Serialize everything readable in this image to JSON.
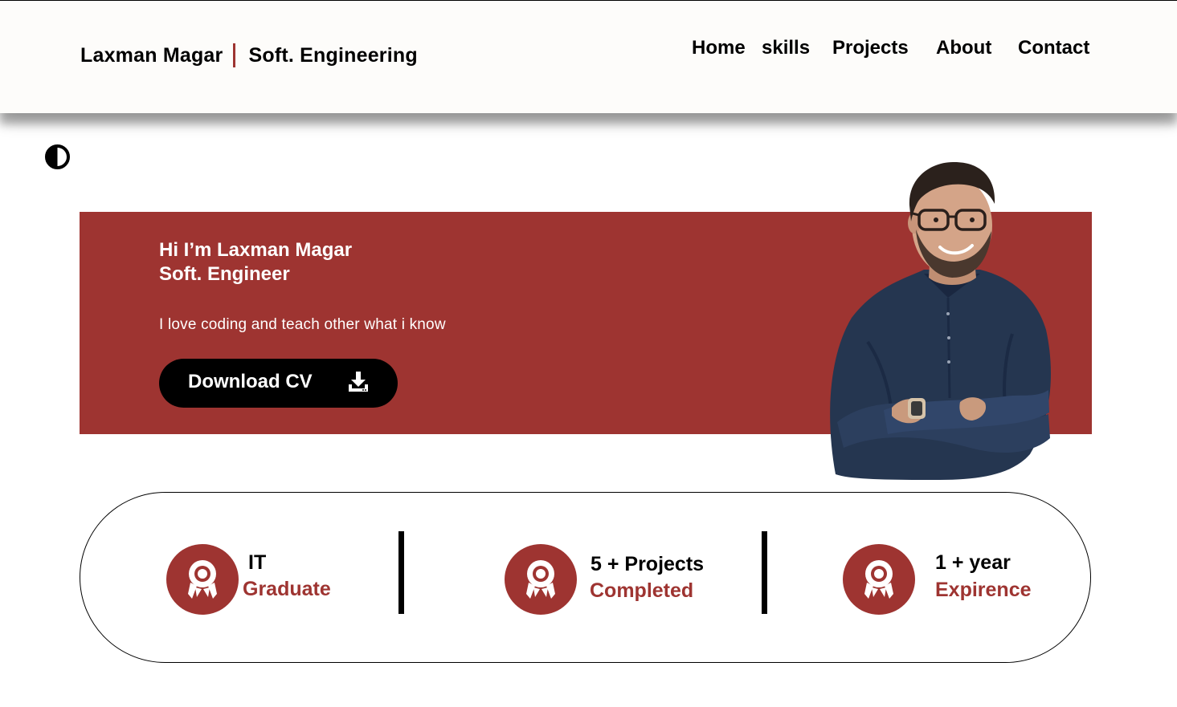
{
  "header": {
    "name": "Laxman Magar",
    "role": "Soft. Engineering",
    "nav": [
      "Home",
      "skills",
      "Projects",
      "About",
      "Contact"
    ]
  },
  "theme_toggle": {
    "icon": "contrast-icon"
  },
  "hero": {
    "greeting": "Hi I’m Laxman Magar",
    "title": "Soft. Engineer",
    "description": "I love coding and teach other what i know",
    "button_label": "Download CV",
    "button_icon": "download-icon"
  },
  "stats": [
    {
      "top": "IT",
      "bottom": "Graduate",
      "icon": "award-icon"
    },
    {
      "top": "5 + Projects",
      "bottom": "Completed",
      "icon": "award-icon"
    },
    {
      "top": "1 + year",
      "bottom": "Expirence",
      "icon": "award-icon"
    }
  ],
  "colors": {
    "accent": "#9e3431",
    "header_bg": "#fdfcfa",
    "button_bg": "#000000",
    "text": "#000000"
  }
}
